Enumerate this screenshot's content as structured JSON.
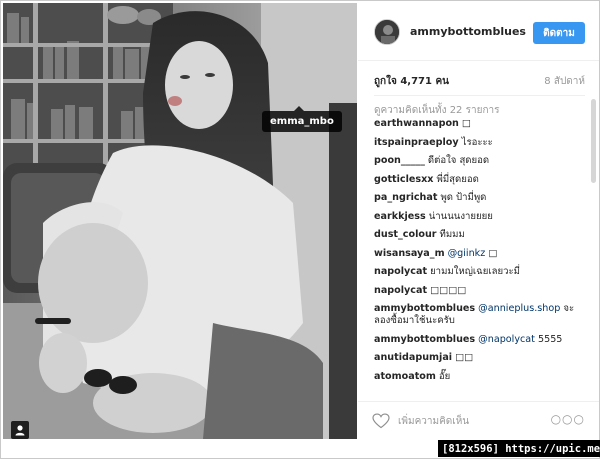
{
  "photo": {
    "tag_label": "emma_mbo",
    "user_badge_icon": "person-icon"
  },
  "header": {
    "avatar_icon": "avatar",
    "username": "ammybottomblues",
    "follow_label": "ติดตาม"
  },
  "meta": {
    "likes": "ถูกใจ 4,771 คน",
    "date": "8 สัปดาห์"
  },
  "view_all": "ดูความคิดเห็นทั้ง 22 รายการ",
  "comments": [
    {
      "user": "earthwannapon",
      "text": "",
      "mention": "",
      "tail": "□"
    },
    {
      "user": "itspainpraeploy",
      "text": "ไรอะะะ",
      "mention": "",
      "tail": ""
    },
    {
      "user": "poon_____",
      "text": "ดีต่อใจ สุดยอด",
      "mention": "",
      "tail": ""
    },
    {
      "user": "gotticlesxx",
      "text": "พี่มี่สุดยอด",
      "mention": "",
      "tail": ""
    },
    {
      "user": "pa_ngrichat",
      "text": "พูด ป้ามี่พูด",
      "mention": "",
      "tail": ""
    },
    {
      "user": "earkkjess",
      "text": "น่านนนงายยยย",
      "mention": "",
      "tail": ""
    },
    {
      "user": "dust_colour",
      "text": "ทีมมม",
      "mention": "",
      "tail": ""
    },
    {
      "user": "wisansaya_m",
      "text": "",
      "mention": "@giinkz",
      "tail": " □"
    },
    {
      "user": "napolycat",
      "text": "ยามมใหญ่เฉยเลยวะมี่",
      "mention": "",
      "tail": ""
    },
    {
      "user": "napolycat",
      "text": "□□□□",
      "mention": "",
      "tail": ""
    },
    {
      "user": "ammybottomblues",
      "text": "",
      "mention": "@annieplus.shop",
      "tail": " จะลองซื้อมาใช้นะครับ"
    },
    {
      "user": "ammybottomblues",
      "text": "",
      "mention": "@napolycat",
      "tail": " 5555"
    },
    {
      "user": "anutidapumjai",
      "text": "□□",
      "mention": "",
      "tail": ""
    },
    {
      "user": "atomoatom",
      "text": "อั๊ย",
      "mention": "",
      "tail": ""
    }
  ],
  "footer": {
    "heart_icon": "heart-icon",
    "add_comment_placeholder": "เพิ่มความคิดเห็น",
    "more_label": "○○○"
  },
  "watermark": "[812x596] https://upic.me/",
  "colors": {
    "accent": "#3897f0",
    "mention": "#003569",
    "muted": "#999999"
  }
}
